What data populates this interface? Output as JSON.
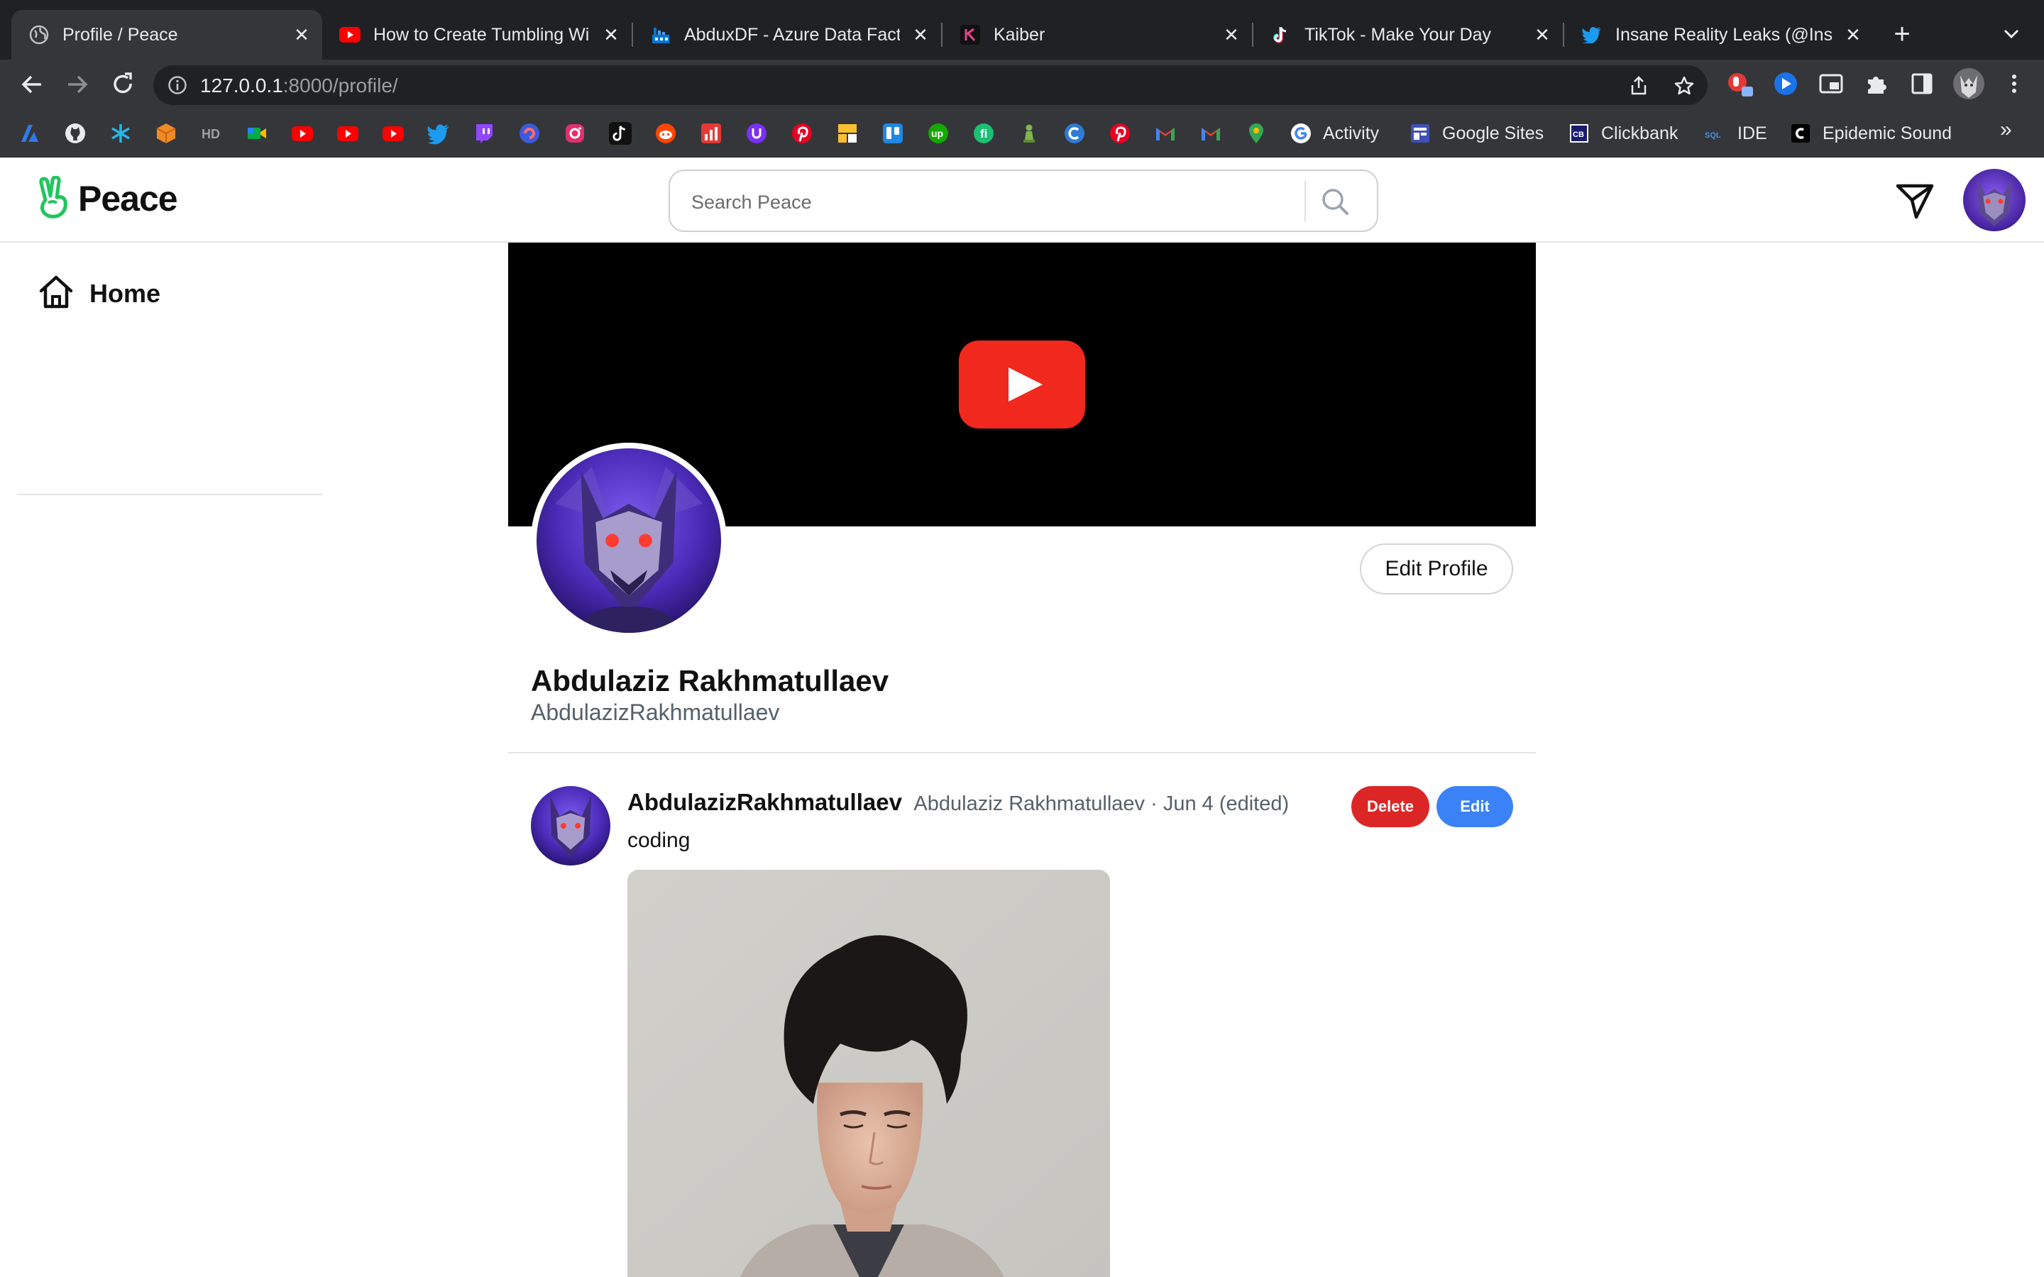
{
  "browser": {
    "tabs": [
      {
        "title": "Profile / Peace",
        "icon": "globe-icon",
        "active": true
      },
      {
        "title": "How to Create Tumbling Wi",
        "icon": "youtube-icon"
      },
      {
        "title": "AbduxDF - Azure Data Fact",
        "icon": "azure-data-factory-icon"
      },
      {
        "title": "Kaiber",
        "icon": "kaiber-icon"
      },
      {
        "title": "TikTok - Make Your Day",
        "icon": "tiktok-icon"
      },
      {
        "title": "Insane Reality Leaks (@Insa",
        "icon": "twitter-icon"
      }
    ],
    "address": {
      "host": "127.0.0.1",
      "rest": ":8000/profile/"
    },
    "bookmarks": [
      {
        "label": "Activity",
        "icon": "google-icon"
      },
      {
        "label": "Google Sites",
        "icon": "google-sites-icon"
      },
      {
        "label": "Clickbank",
        "icon": "clickbank-icon"
      },
      {
        "label": "IDE",
        "icon": "sql-icon"
      },
      {
        "label": "Epidemic Sound",
        "icon": "epidemic-sound-icon"
      }
    ],
    "bookmark_more": "»"
  },
  "site": {
    "logo_text": "Peace",
    "logo_color": "#22c55e",
    "search": {
      "placeholder": "Search Peace"
    }
  },
  "sidebar": {
    "items": [
      {
        "label": "Home",
        "icon": "home-icon"
      }
    ]
  },
  "profile": {
    "full_name": "Abdulaziz Rakhmatullaev",
    "username": "AbdulazizRakhmatullaev",
    "edit_button": "Edit Profile"
  },
  "post": {
    "username": "AbdulazizRakhmatullaev",
    "full_name": "Abdulaziz Rakhmatullaev",
    "separator": "·",
    "date": "Jun 4 (edited)",
    "text": "coding",
    "delete_label": "Delete",
    "edit_label": "Edit",
    "delete_color": "#dc2626",
    "edit_color": "#3b82f6"
  }
}
